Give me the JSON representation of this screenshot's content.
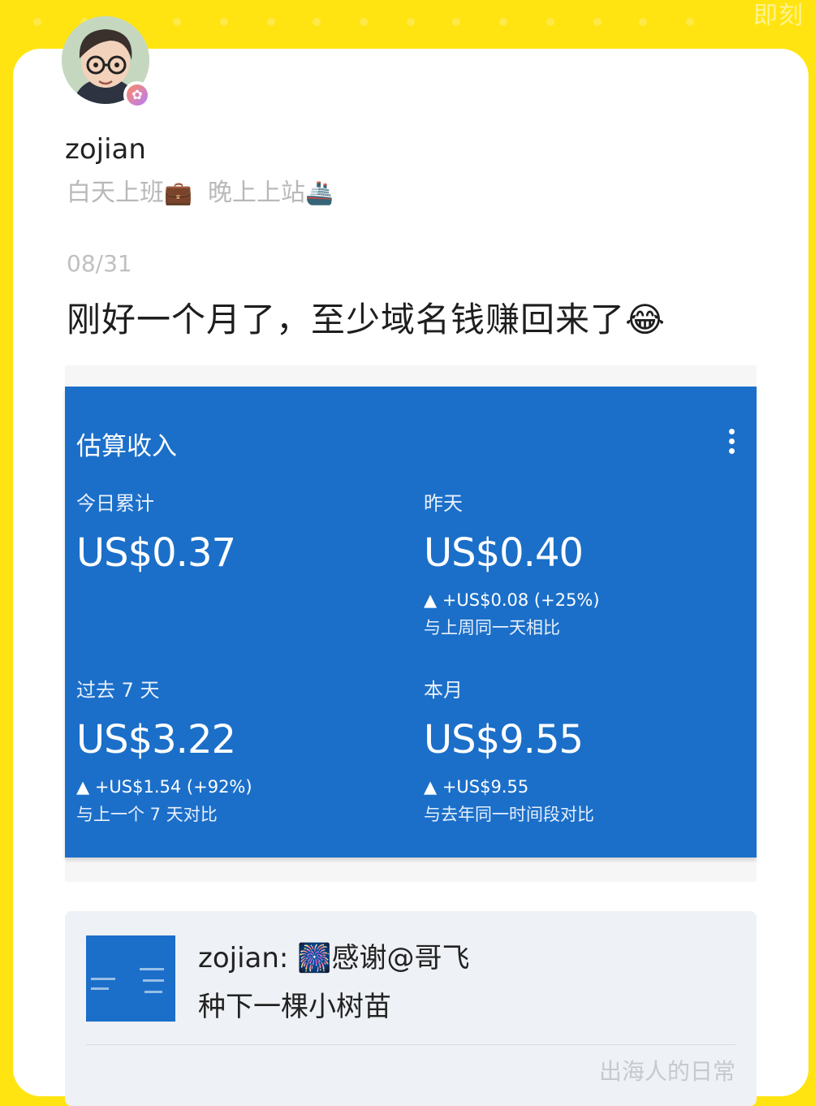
{
  "app": {
    "watermark": "即刻"
  },
  "post": {
    "author": "zojian",
    "bio_text": "白天上班",
    "bio_emoji1": "💼",
    "bio_text2": "晚上上站",
    "bio_emoji2": "🚢",
    "date": "08/31",
    "text": "刚好一个月了，至少域名钱赚回来了",
    "text_emoji": "😂"
  },
  "screenshot": {
    "title": "估算收入",
    "metrics": [
      {
        "label": "今日累计",
        "value": "US$0.37",
        "delta": "",
        "compare": ""
      },
      {
        "label": "昨天",
        "value": "US$0.40",
        "delta": "▲ +US$0.08 (+25%)",
        "compare": "与上周同一天相比"
      },
      {
        "label": "过去 7 天",
        "value": "US$3.22",
        "delta": "▲ +US$1.54 (+92%)",
        "compare": "与上一个 7 天对比"
      },
      {
        "label": "本月",
        "value": "US$9.55",
        "delta": "▲ +US$9.55",
        "compare": "与去年同一时间段对比"
      }
    ]
  },
  "share": {
    "line1_prefix": "zojian: ",
    "line1_emoji": "🎆",
    "line1_text": "感谢@哥飞",
    "line2": "种下一棵小树苗",
    "footer": "出海人的日常"
  },
  "colors": {
    "background": "#FFE411",
    "card": "#FFFFFF",
    "adsense_blue": "#1B6FC9"
  }
}
